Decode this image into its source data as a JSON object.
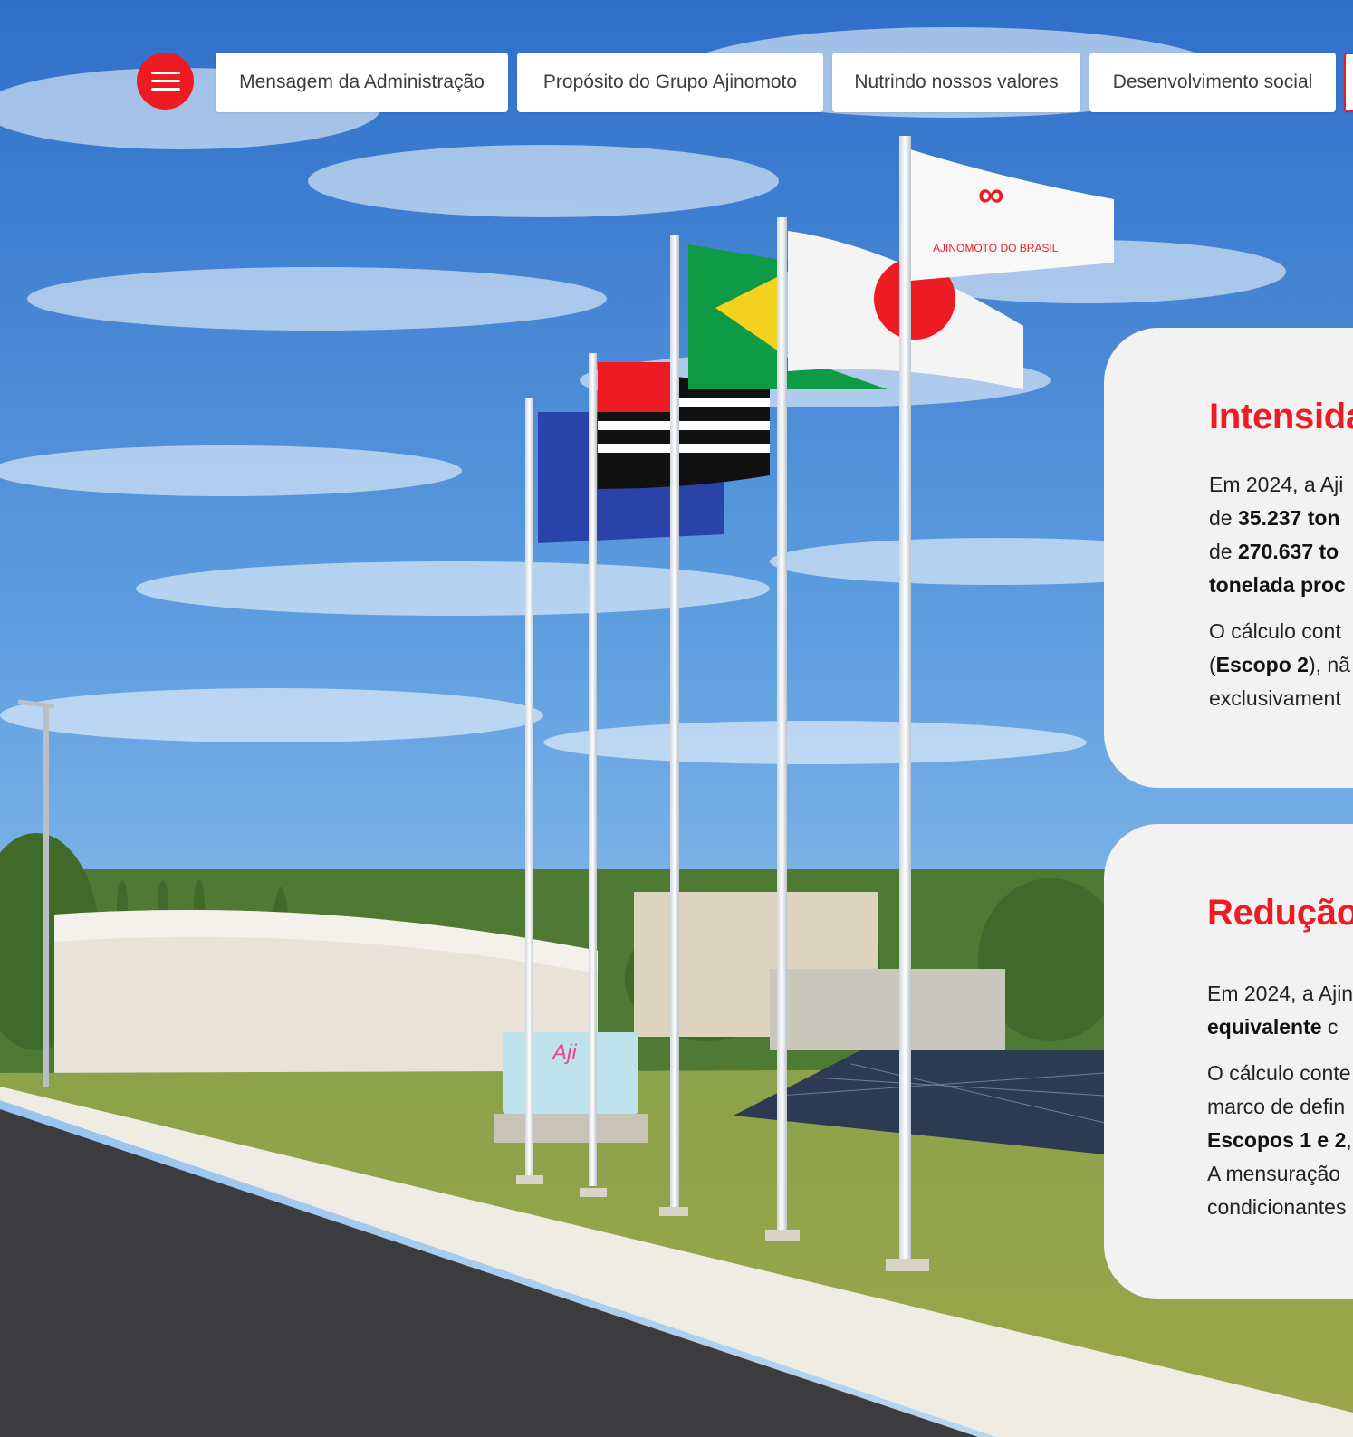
{
  "nav": {
    "menu_label": "Menu",
    "items": [
      {
        "label": "Mensagem da Administração"
      },
      {
        "label": "Propósito do Grupo Ajinomoto"
      },
      {
        "label": "Nutrindo nossos valores"
      },
      {
        "label": "Desenvolvimento social"
      }
    ]
  },
  "hero": {
    "flag_company_text": "AJINOMOTO DO BRASIL",
    "monument_text": "Aji"
  },
  "cards": [
    {
      "title": "Intensida",
      "p1_l1": "Em 2024, a Aji",
      "p1_l2_a": "de ",
      "p1_l2_b": "35.237 ton",
      "p1_l3_a": "de ",
      "p1_l3_b": "270.637 to",
      "p1_l4_b": "tonelada proc",
      "p2_l1": "O cálculo cont",
      "p2_l2_a": "(",
      "p2_l2_b": "Escopo 2",
      "p2_l2_c": "), nã",
      "p2_l3": "exclusivament"
    },
    {
      "title": "Redução",
      "p1_l1": "Em 2024, a Ajin",
      "p1_l2_b": "equivalente",
      "p1_l2_c": " c",
      "p2_l1": "O cálculo conte",
      "p2_l2": "marco de defin",
      "p2_l3_b": "Escopos 1 e 2",
      "p2_l3_c": ",",
      "p2_l4": "A mensuração",
      "p2_l5": "condicionantes"
    }
  ],
  "colors": {
    "accent": "#ed1c24",
    "card_bg": "#f2f2f2",
    "sky": "#4d8fd6"
  }
}
